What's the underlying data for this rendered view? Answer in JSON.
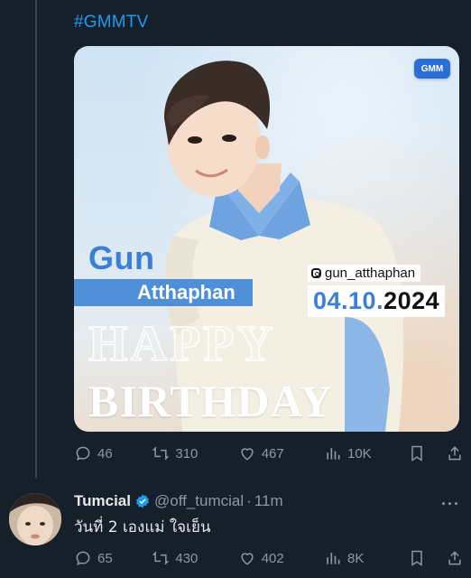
{
  "tweet": {
    "hashtag": "#GMMTV",
    "image": {
      "logo": "GMM",
      "first_name": "Gun",
      "last_name": "Atthaphan",
      "instagram": "gun_atthaphan",
      "date_dm": "04.10.",
      "date_year": "2024",
      "happy": "HAPPY",
      "birthday": "BIRTHDAY"
    },
    "stats": {
      "replies": "46",
      "retweets": "310",
      "likes": "467",
      "views": "10K"
    }
  },
  "reply": {
    "name": "Tumcial",
    "handle": "@off_tumcial",
    "separator": "·",
    "time": "11m",
    "text": "วันที่ 2 เองแม่ ใจเย็น",
    "stats": {
      "replies": "65",
      "retweets": "430",
      "likes": "402",
      "views": "8K"
    }
  },
  "icons": {
    "reply": "reply-icon",
    "retweet": "retweet-icon",
    "like": "heart-icon",
    "views": "views-icon",
    "bookmark": "bookmark-icon",
    "share": "share-icon",
    "verified": "verified-badge-icon",
    "more": "more-icon"
  },
  "colors": {
    "background": "#15202b",
    "accent": "#1d9bf0",
    "muted": "#8b98a5"
  }
}
